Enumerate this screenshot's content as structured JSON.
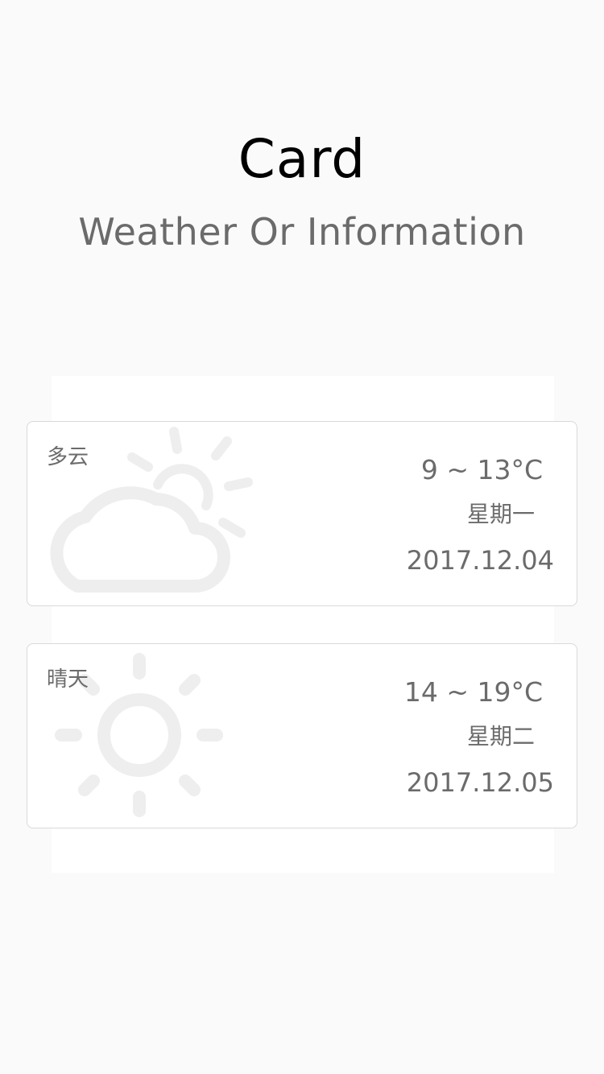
{
  "header": {
    "title": "Card",
    "subtitle": "Weather Or Information"
  },
  "colors": {
    "background": "#fafafa",
    "panel": "#ffffff",
    "card_border": "#d9d9d9",
    "text_primary": "#000000",
    "text_secondary": "#6b6b6b",
    "icon_watermark": "#eeeeee"
  },
  "cards": [
    {
      "condition": "多云",
      "icon": "partly-cloudy-icon",
      "temp": "9 ~ 13°C",
      "weekday": "星期一",
      "date": "2017.12.04"
    },
    {
      "condition": "晴天",
      "icon": "sunny-icon",
      "temp": "14 ~ 19°C",
      "weekday": "星期二",
      "date": "2017.12.05"
    }
  ]
}
